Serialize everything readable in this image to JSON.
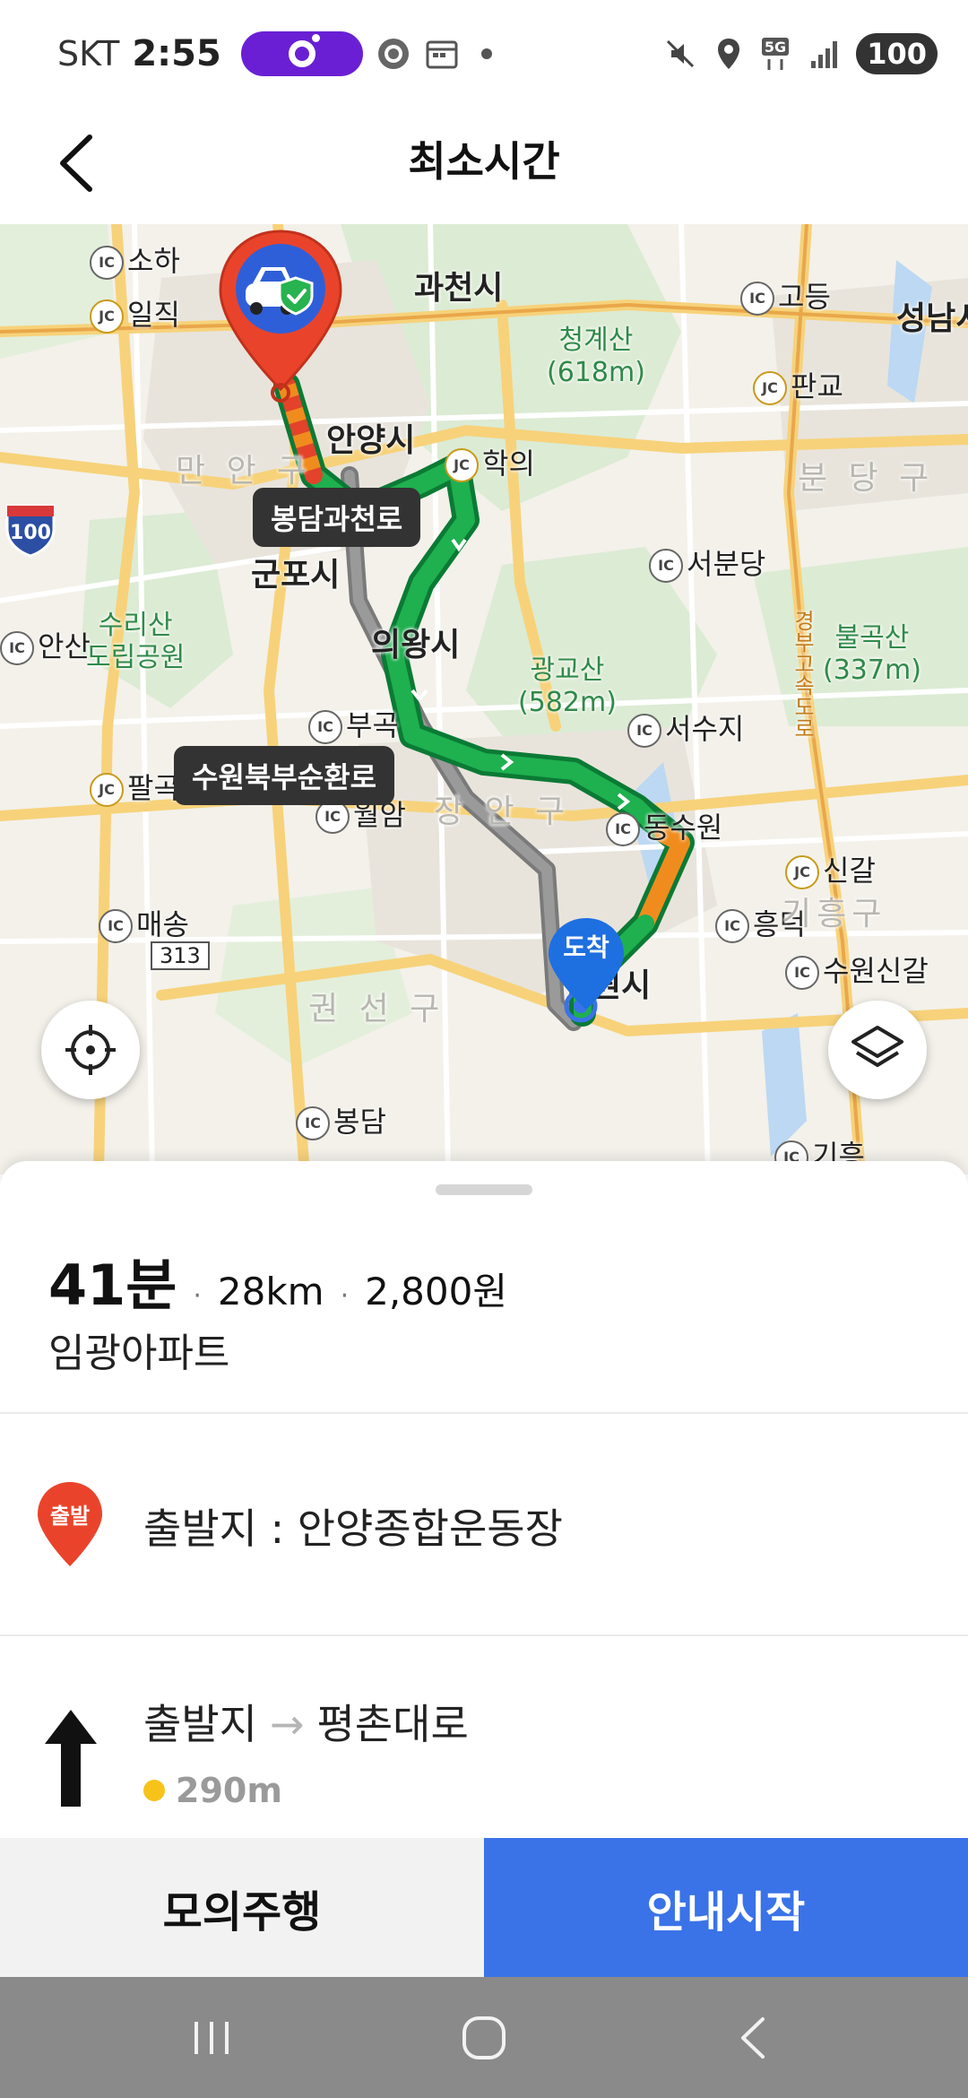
{
  "status_bar": {
    "carrier": "SKT",
    "time": "2:55",
    "network": "5G",
    "battery": "100"
  },
  "header": {
    "title": "최소시간"
  },
  "map": {
    "labels": {
      "gwacheon": "과천시",
      "anyang": "안양시",
      "gunpo": "군포시",
      "uiwang": "의왕시",
      "suwon": "원시",
      "seongnam": "성남시",
      "soha": "소하",
      "ilsik": "일직",
      "hakui": "학의",
      "godeung": "고등",
      "pangyo": "판교",
      "seobundang": "서분당",
      "seosuji": "서수지",
      "bugok": "부곡",
      "palgok": "팔곡",
      "dongsuwon": "동수원",
      "singal": "신갈",
      "heungdeok": "흥덕",
      "suwonsingal": "수원신갈",
      "maesong": "매송",
      "bongdam": "봉담",
      "giheung": "기흥",
      "ansan": "안산",
      "wolam": "월암",
      "giheung_gu": "기흥구",
      "manan_gu": "만 안 구",
      "bundang_gu": "분 당 구",
      "jangan_gu": "장 안 구",
      "gwonseon_gu": "권 선 구",
      "cheonggyesan": "청계산",
      "cheonggyesan_h": "(618m)",
      "gwanggyosan": "광교산",
      "gwanggyosan_h": "(582m)",
      "bulgoksan": "불곡산",
      "bulgoksan_h": "(337m)",
      "surisan_1": "수리산",
      "surisan_2": "도립공원",
      "highway_100": "100",
      "road_313": "313",
      "expressway": "경부고속도로"
    },
    "road_tags": {
      "tag1": "봉담과천로",
      "tag2": "수원북부순환로"
    },
    "arrival_badge": "도착"
  },
  "route": {
    "time": "41분",
    "distance": "28km",
    "toll": "2,800원",
    "destination": "임광아파트"
  },
  "origin": {
    "badge": "출발",
    "label": "출발지 : 안양종합운동장"
  },
  "first_step": {
    "from": "출발지",
    "arrow": "→",
    "to": "평촌대로",
    "distance": "290m"
  },
  "actions": {
    "simulate": "모의주행",
    "start": "안내시작"
  },
  "colors": {
    "route_fast": "#1fb04f",
    "route_slow": "#f08c1e",
    "route_jam": "#e2432a",
    "route_alt": "#8c8c8c",
    "start_button": "#3a72e8",
    "origin_pin": "#e9442b",
    "arrival_pin": "#1e6fe0"
  }
}
